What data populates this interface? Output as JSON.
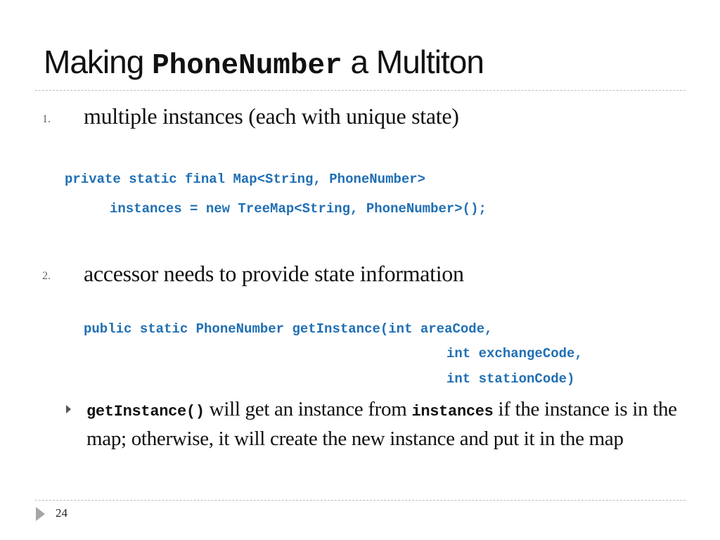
{
  "slide": {
    "title": {
      "prefix": "Making ",
      "code": "PhoneNumber",
      "suffix": " a Multiton"
    },
    "items": [
      {
        "number": "1.",
        "text": "multiple instances (each with unique state)",
        "code_lines": [
          "private static final Map<String, PhoneNumber>",
          "instances = new TreeMap<String, PhoneNumber>();"
        ]
      },
      {
        "number": "2.",
        "text": "accessor needs to provide state information",
        "code_lines": [
          "public static PhoneNumber getInstance(int areaCode,",
          "int exchangeCode,",
          "int stationCode)"
        ],
        "sub_bullet": {
          "code_start": "getInstance()",
          "text_1": " will get an instance from ",
          "code_mid": "instances",
          "text_2": " if the instance is in the map; otherwise, it will create the new instance and put it in the map"
        }
      }
    ],
    "page_number": "24"
  },
  "colors": {
    "code": "#1f6fb4",
    "text": "#111111",
    "rule": "#bdbdbd",
    "footer_arrow": "#a6a6a6"
  }
}
